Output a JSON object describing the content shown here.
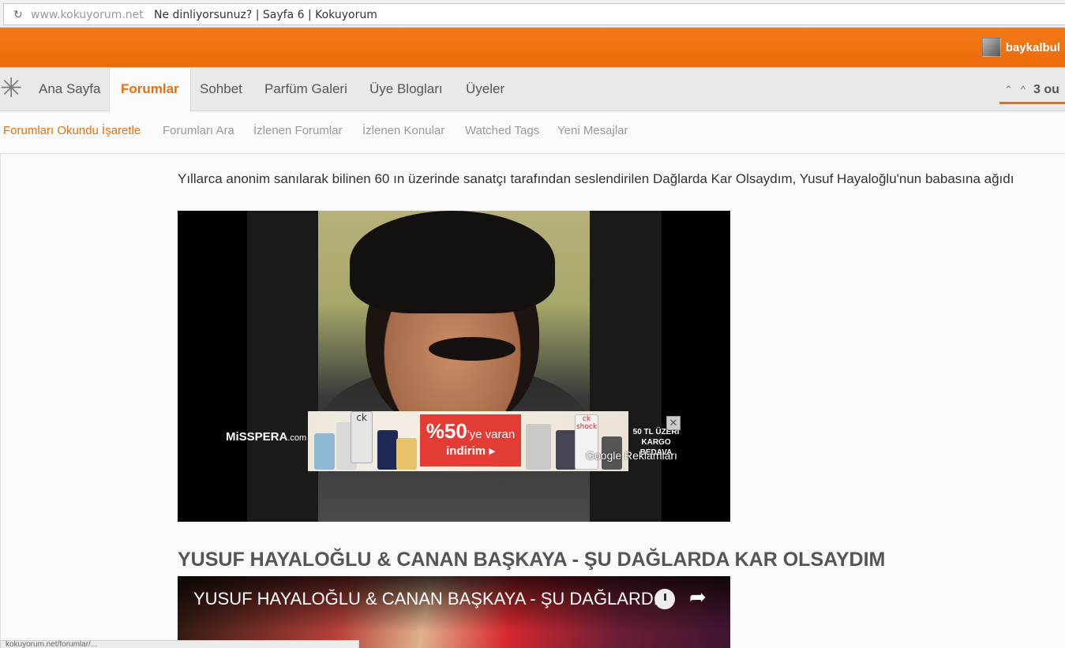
{
  "browser": {
    "reload_icon": "reload-icon",
    "url": "www.kokuyorum.net",
    "page_title": "Ne dinliyorsunuz? | Sayfa 6 | Kokuyorum"
  },
  "topbar": {
    "username": "baykalbul"
  },
  "nav": {
    "logo_glyph": "✳",
    "tabs": [
      "Ana Sayfa",
      "Forumlar",
      "Sohbet",
      "Parfüm Galeri",
      "Üye Blogları",
      "Üyeler"
    ],
    "active_tab": "Forumlar",
    "right_text": "3 ou"
  },
  "subnav": {
    "links": [
      "Forumları Okundu İşaretle",
      "Forumları Ara",
      "İzlenen Forumlar",
      "İzlenen Konular",
      "Watched Tags",
      "Yeni Mesajlar"
    ]
  },
  "post": {
    "intro": "Yıllarca anonim sanılarak bilinen 60 ın üzerinde sanatçı tarafından seslendirilen Dağlarda Kar Olsaydım, Yusuf Hayaloğlu'nun babasına ağıdı",
    "song_title": "YUSUF HAYALOĞLU & CANAN BAŞKAYA - ŞU DAĞLARDA KAR OLSAYDIM"
  },
  "ad": {
    "brand": "MiSSPERA",
    "brand_suffix": ".com",
    "promo_percent": "%50",
    "promo_suffix": "'ye varan",
    "promo_line2": "indirim ▸",
    "cargo": "50 TL ÜZERİ KARGO BEDAVA",
    "close": "✕",
    "label": "Google Reklamları",
    "bottle_label_1": "ck",
    "bottle_label_2": "ck shock"
  },
  "youtube": {
    "title": "YUSUF HAYALOĞLU & CANAN BAŞKAYA - ŞU DAĞLARD...",
    "share_glyph": "➦"
  },
  "status": {
    "text": "kokuyorum.net/forumlar/..."
  }
}
